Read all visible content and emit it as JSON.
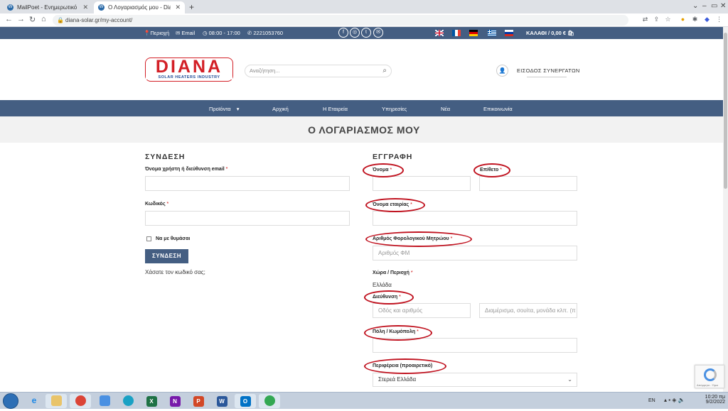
{
  "browser": {
    "tabs": [
      {
        "title": "MailPoet - Ενημερωτικό δελτίο -",
        "active": false
      },
      {
        "title": "Ο Λογαριασμός μου - Diana Sola",
        "active": true
      }
    ],
    "url": "diana-solar.gr/my-account/"
  },
  "topbar": {
    "region": "Περιοχή",
    "email": "Email",
    "hours": "08:00 - 17:00",
    "phone": "2221053760",
    "cart": "ΚΑΛΑΘΙ / 0,00 €"
  },
  "header": {
    "logo_main": "DIANA",
    "logo_sub": "SOLAR HEATERS INDUSTRY",
    "search_placeholder": "Αναζήτηση...",
    "partner_login": "ΕΙΣΟΔΟΣ ΣΥΝΕΡΓΑΤΩΝ"
  },
  "nav": {
    "items": [
      "Προϊόντα",
      "Αρχική",
      "Η Εταιρεία",
      "Υπηρεσίες",
      "Νέα",
      "Επικοινωνία"
    ],
    "dropdown_caret": "▾"
  },
  "page_title": "Ο ΛΟΓΑΡΙΑΣΜΟΣ ΜΟΥ",
  "login": {
    "title": "ΣΥΝΔΕΣΗ",
    "username_label": "Όνομα χρήστη ή διεύθυνση email",
    "password_label": "Κωδικός",
    "remember_label": "Να με θυμάσαι",
    "button": "ΣΥΝΔΕΣΗ",
    "lost_password": "Χάσατε τον κωδικό σας;"
  },
  "register": {
    "title": "ΕΓΓΡΑΦΗ",
    "first_name_label": "Όνομα",
    "last_name_label": "Επίθετο",
    "company_label": "Όνομα εταιρίας",
    "vat_label": "Αριθμός Φορολογικού Μητρώου",
    "vat_placeholder": "Αριθμός ΦΜ",
    "country_label": "Χώρα / Περιοχή",
    "country_value": "Ελλάδα",
    "address_label": "Διεύθυνση",
    "address1_placeholder": "Οδός και αριθμός",
    "address2_placeholder": "Διαμέρισμα, σουίτα, μονάδα κλπ. (π",
    "city_label": "Πόλη / Κωμόπολη",
    "region_label": "Περιφέρεια (προαιρετικό)",
    "region_value": "Στερεά Ελλάδα",
    "required_mark": "*"
  },
  "recaptcha": {
    "text": "Απόρρητο - Όροι"
  },
  "taskbar": {
    "lang": "EN",
    "time": "10:20 πμ",
    "date": "9/2/2022"
  },
  "colors": {
    "brand_blue": "#445e82",
    "brand_red": "#d31f26",
    "annotation_red": "#c0121f"
  }
}
